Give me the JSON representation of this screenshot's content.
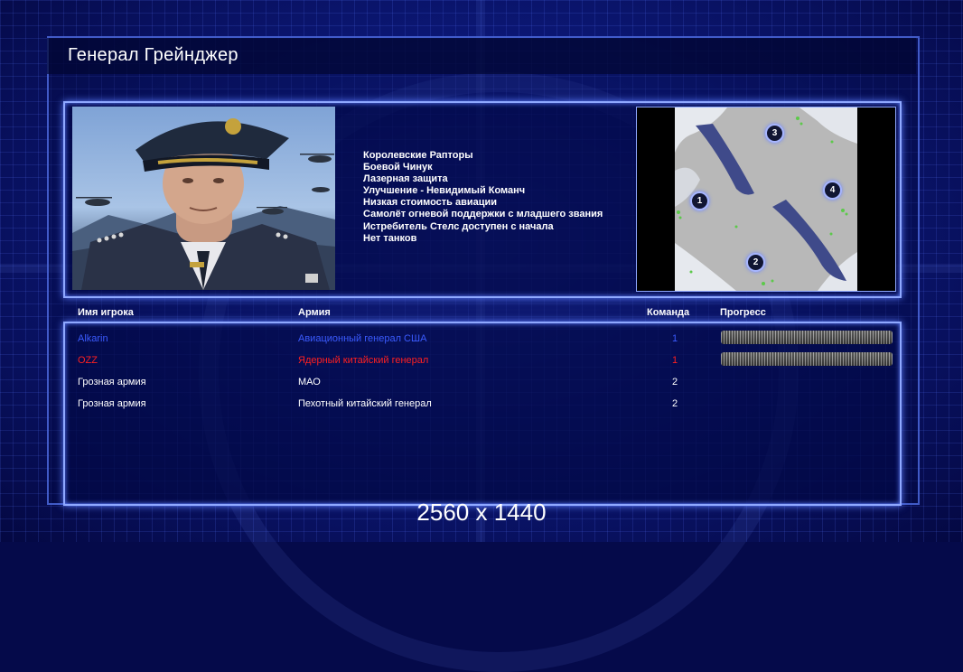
{
  "screen": {
    "title": "Генерал Грейнджер",
    "resolution_label": "2560 x 1440"
  },
  "general": {
    "traits": [
      "Королевские Рапторы",
      "Боевой Чинук",
      "Лазерная защита",
      "Улучшение - Невидимый Команч",
      "Низкая стоимость авиации",
      "Самолёт огневой поддержки с младшего звания",
      "Истребитель Стелс доступен с начала",
      "Нет танков"
    ]
  },
  "map": {
    "start_positions": [
      "1",
      "2",
      "3",
      "4"
    ]
  },
  "players_table": {
    "headers": {
      "name": "Имя игрока",
      "army": "Армия",
      "team": "Команда",
      "progress": "Прогресс"
    },
    "rows": [
      {
        "name": "Alkarin",
        "army": "Авиационный генерал США",
        "team": "1",
        "color": "#3b5bff",
        "progress": 1.0
      },
      {
        "name": "OZZ",
        "army": "Ядерный китайский генерал",
        "team": "1",
        "color": "#ff2020",
        "progress": 1.0
      },
      {
        "name": "Грозная армия",
        "army": "МАО",
        "team": "2",
        "color": "#ffffff"
      },
      {
        "name": "Грозная армия",
        "army": "Пехотный китайский генерал",
        "team": "2",
        "color": "#ffffff"
      }
    ]
  },
  "colors": {
    "frame_glow": "#8fa8ff",
    "background": "#0c1878"
  }
}
